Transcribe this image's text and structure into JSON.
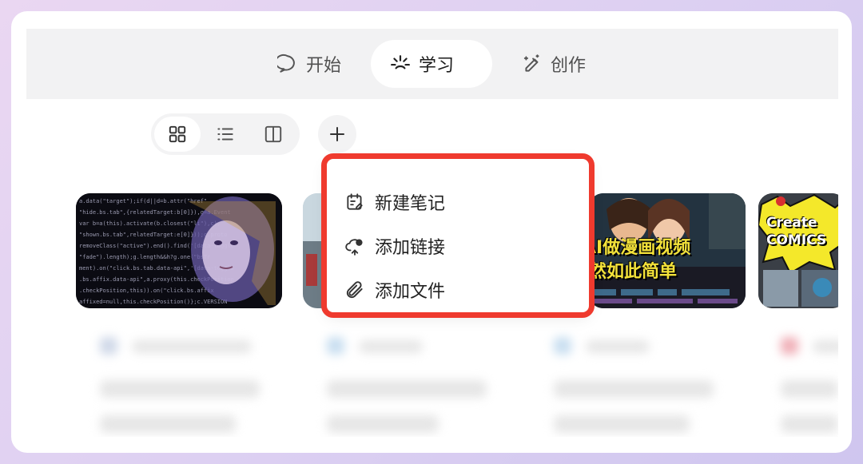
{
  "tabs": [
    {
      "label": "开始",
      "icon": "chat-bubble-icon",
      "active": false
    },
    {
      "label": "学习",
      "icon": "sparkle-icon",
      "active": true
    },
    {
      "label": "创作",
      "icon": "magic-pen-icon",
      "active": false
    }
  ],
  "view_modes": [
    {
      "icon": "grid-view-icon",
      "active": true
    },
    {
      "icon": "list-view-icon",
      "active": false
    },
    {
      "icon": "split-view-icon",
      "active": false
    }
  ],
  "add_button": {
    "icon": "plus-icon"
  },
  "dropdown_menu": {
    "items": [
      {
        "label": "新建笔记",
        "icon": "calendar-note-icon"
      },
      {
        "label": "添加链接",
        "icon": "cloud-link-icon"
      },
      {
        "label": "添加文件",
        "icon": "paperclip-icon"
      }
    ],
    "highlight_color": "#ef3a2e"
  },
  "cards": [
    {
      "thumb": "ai-face-code-image"
    },
    {
      "thumb": "partial-image"
    },
    {
      "thumb": "ai-comic-video-image",
      "overlay_line1": "AI做漫画视频",
      "overlay_line2": "然如此简单"
    },
    {
      "thumb": "create-comics-image",
      "overlay": "Create COMICS"
    }
  ],
  "colors": {
    "accent": "#ef3a2e",
    "tab_bar": "#f2f2f3"
  }
}
